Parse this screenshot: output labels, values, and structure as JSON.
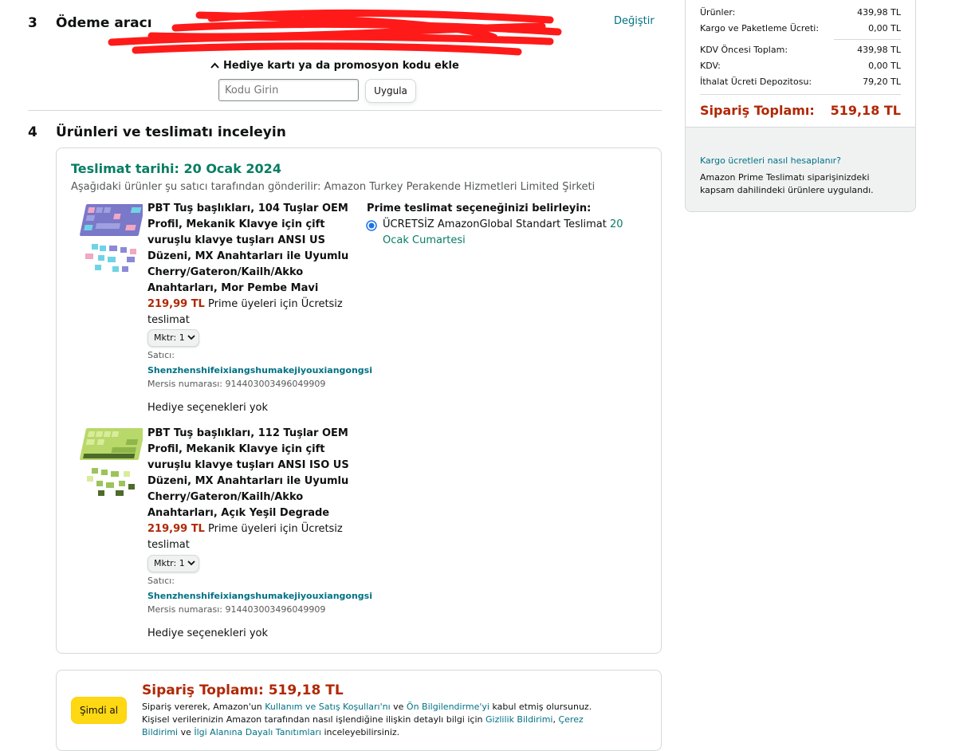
{
  "payment": {
    "number": "3",
    "title": "Ödeme aracı",
    "change_link": "Değiştir",
    "promo_toggle": "Hediye kartı ya da promosyon kodu ekle",
    "promo_placeholder": "Kodu Girin",
    "apply_button": "Uygula"
  },
  "review": {
    "number": "4",
    "title": "Ürünleri ve teslimatı inceleyin",
    "delivery_date": "Teslimat tarihi: 20 Ocak 2024",
    "shipped_by": "Aşağıdaki ürünler şu satıcı tarafından gönderilir: Amazon Turkey Perakende Hizmetleri Limited Şirketi",
    "delivery_option_heading": "Prime teslimat seçeneğinizi belirleyin:",
    "delivery_option_text": "ÜCRETSİZ AmazonGlobal Standart Teslimat",
    "delivery_option_date": "20 Ocak Cumartesi",
    "items": [
      {
        "title": "PBT Tuş başlıkları, 104 Tuşlar OEM Profil, Mekanik Klavye için çift vuruşlu klavye tuşları ANSI US Düzeni, MX Anahtarları ile Uyumlu Cherry/Gateron/Kailh/Akko Anahtarları, Mor Pembe Mavi",
        "price": "219,99 TL",
        "shipping_note": "Prime üyeleri için Ücretsiz teslimat",
        "qty_label": "Mktr:",
        "qty_value": "1",
        "seller_label": "Satıcı:",
        "seller": "Shenzhenshifeixiangshumakejiyouxiangongsi",
        "mersis": "Mersis numarası: 914403003496049909",
        "gift": "Hediye seçenekleri yok"
      },
      {
        "title": "PBT Tuş başlıkları, 112 Tuşlar OEM Profil, Mekanik Klavye için çift vuruşlu klavye tuşları ANSI ISO US Düzeni, MX Anahtarları ile Uyumlu Cherry/Gateron/Kailh/Akko Anahtarları, Açık Yeşil Degrade",
        "price": "219,99 TL",
        "shipping_note": "Prime üyeleri için Ücretsiz teslimat",
        "qty_label": "Mktr:",
        "qty_value": "1",
        "seller_label": "Satıcı:",
        "seller": "Shenzhenshifeixiangshumakejiyouxiangongsi",
        "mersis": "Mersis numarası: 914403003496049909",
        "gift": "Hediye seçenekleri yok"
      }
    ]
  },
  "summary": {
    "rows": [
      {
        "label": "Ürünler:",
        "value": "439,98 TL"
      },
      {
        "label": "Kargo ve Paketleme Ücreti:",
        "value": "0,00 TL"
      },
      {
        "label": "KDV Öncesi Toplam:",
        "value": "439,98 TL"
      },
      {
        "label": "KDV:",
        "value": "0,00 TL"
      },
      {
        "label": "İthalat Ücreti Depozitosu:",
        "value": "79,20 TL"
      }
    ],
    "total_label": "Sipariş Toplamı:",
    "total_value": "519,18 TL",
    "shipping_calc_link": "Kargo ücretleri nasıl hesaplanır?",
    "prime_note": "Amazon Prime Teslimatı siparişinizdeki kapsam dahilindeki ürünlere uygulandı."
  },
  "bottom": {
    "buy_button": "Şimdi al",
    "total_label": "Sipariş Toplamı:",
    "total_value": "519,18 TL",
    "legal_1": "Sipariş vererek, Amazon'un",
    "legal_link_1": "Kullanım ve Satış Koşulları'nı",
    "legal_2": "ve",
    "legal_link_2": "Ön Bilgilendirme'yi",
    "legal_3": "kabul etmiş olursunuz. Kişisel verilerinizin Amazon tarafından nasıl işlendiğine ilişkin detaylı bilgi için",
    "legal_link_3": "Gizlilik Bildirimi",
    "legal_link_4": "Çerez Bildirimi",
    "legal_4": "ve",
    "legal_link_5": "İlgi Alanına Dayalı Tanıtımları",
    "legal_5": "inceleyebilirsiniz."
  },
  "colors": {
    "accent_green": "#067d62",
    "price_red": "#b12704",
    "link_teal": "#007185",
    "buy_yellow": "#ffd814"
  }
}
